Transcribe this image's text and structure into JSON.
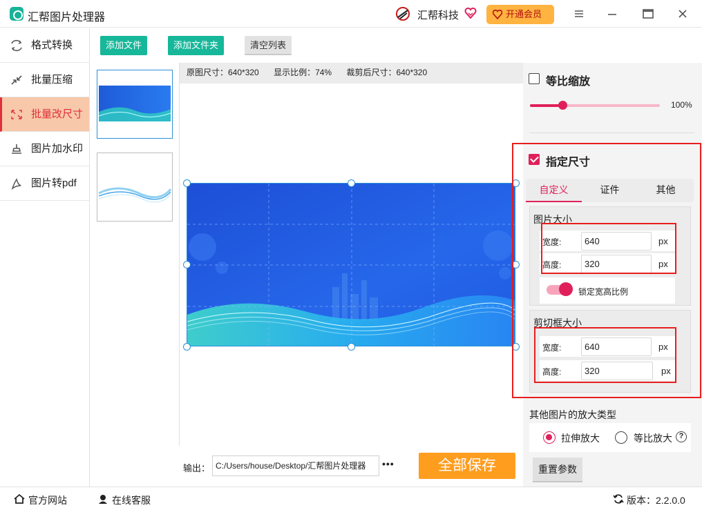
{
  "app": {
    "title": "汇帮图片处理器",
    "brand": "汇帮科技",
    "vip_label": "开通会员"
  },
  "colors": {
    "accent": "#e0205a",
    "green": "#17b79a",
    "orange": "#ff9d1f",
    "active_bg": "#f7c8a9",
    "highlight": "#e81d1d"
  },
  "sidebar": {
    "items": [
      {
        "label": "格式转换",
        "icon": "format-convert-icon"
      },
      {
        "label": "批量压缩",
        "icon": "compress-icon"
      },
      {
        "label": "批量改尺寸",
        "icon": "resize-icon",
        "active": true
      },
      {
        "label": "图片加水印",
        "icon": "watermark-icon"
      },
      {
        "label": "图片转pdf",
        "icon": "pdf-icon"
      }
    ]
  },
  "toolbar": {
    "add_file": "添加文件",
    "add_folder": "添加文件夹",
    "clear_list": "清空列表"
  },
  "preview": {
    "original_size": "原图尺寸：640*320",
    "display_ratio": "显示比例：74%",
    "cropped_size": "裁剪后尺寸：640*320"
  },
  "output": {
    "label": "输出：",
    "path": "C:/Users/house/Desktop/汇帮图片处理器",
    "more": "•••",
    "save_all": "全部保存"
  },
  "scale": {
    "label": "等比缩放",
    "checked": false,
    "percent": "100%",
    "value": 0.25
  },
  "size": {
    "label": "指定尺寸",
    "checked": true,
    "tabs": [
      "自定义",
      "证件",
      "其他"
    ],
    "active_tab": 0,
    "image_size": {
      "title": "图片大小",
      "width_label": "宽度:",
      "width_value": "640",
      "height_label": "高度:",
      "height_value": "320",
      "unit": "px",
      "lock_label": "锁定宽高比例",
      "lock_on": true
    },
    "crop_size": {
      "title": "剪切框大小",
      "width_label": "宽度:",
      "width_value": "640",
      "height_label": "高度:",
      "height_value": "320",
      "unit": "px"
    }
  },
  "enlarge": {
    "title": "其他图片的放大类型",
    "options": [
      "拉伸放大",
      "等比放大"
    ],
    "selected": 0,
    "help": "?"
  },
  "reset_label": "重置参数",
  "status": {
    "website": "官方网站",
    "service": "在线客服",
    "version": "版本：2.2.0.0"
  }
}
